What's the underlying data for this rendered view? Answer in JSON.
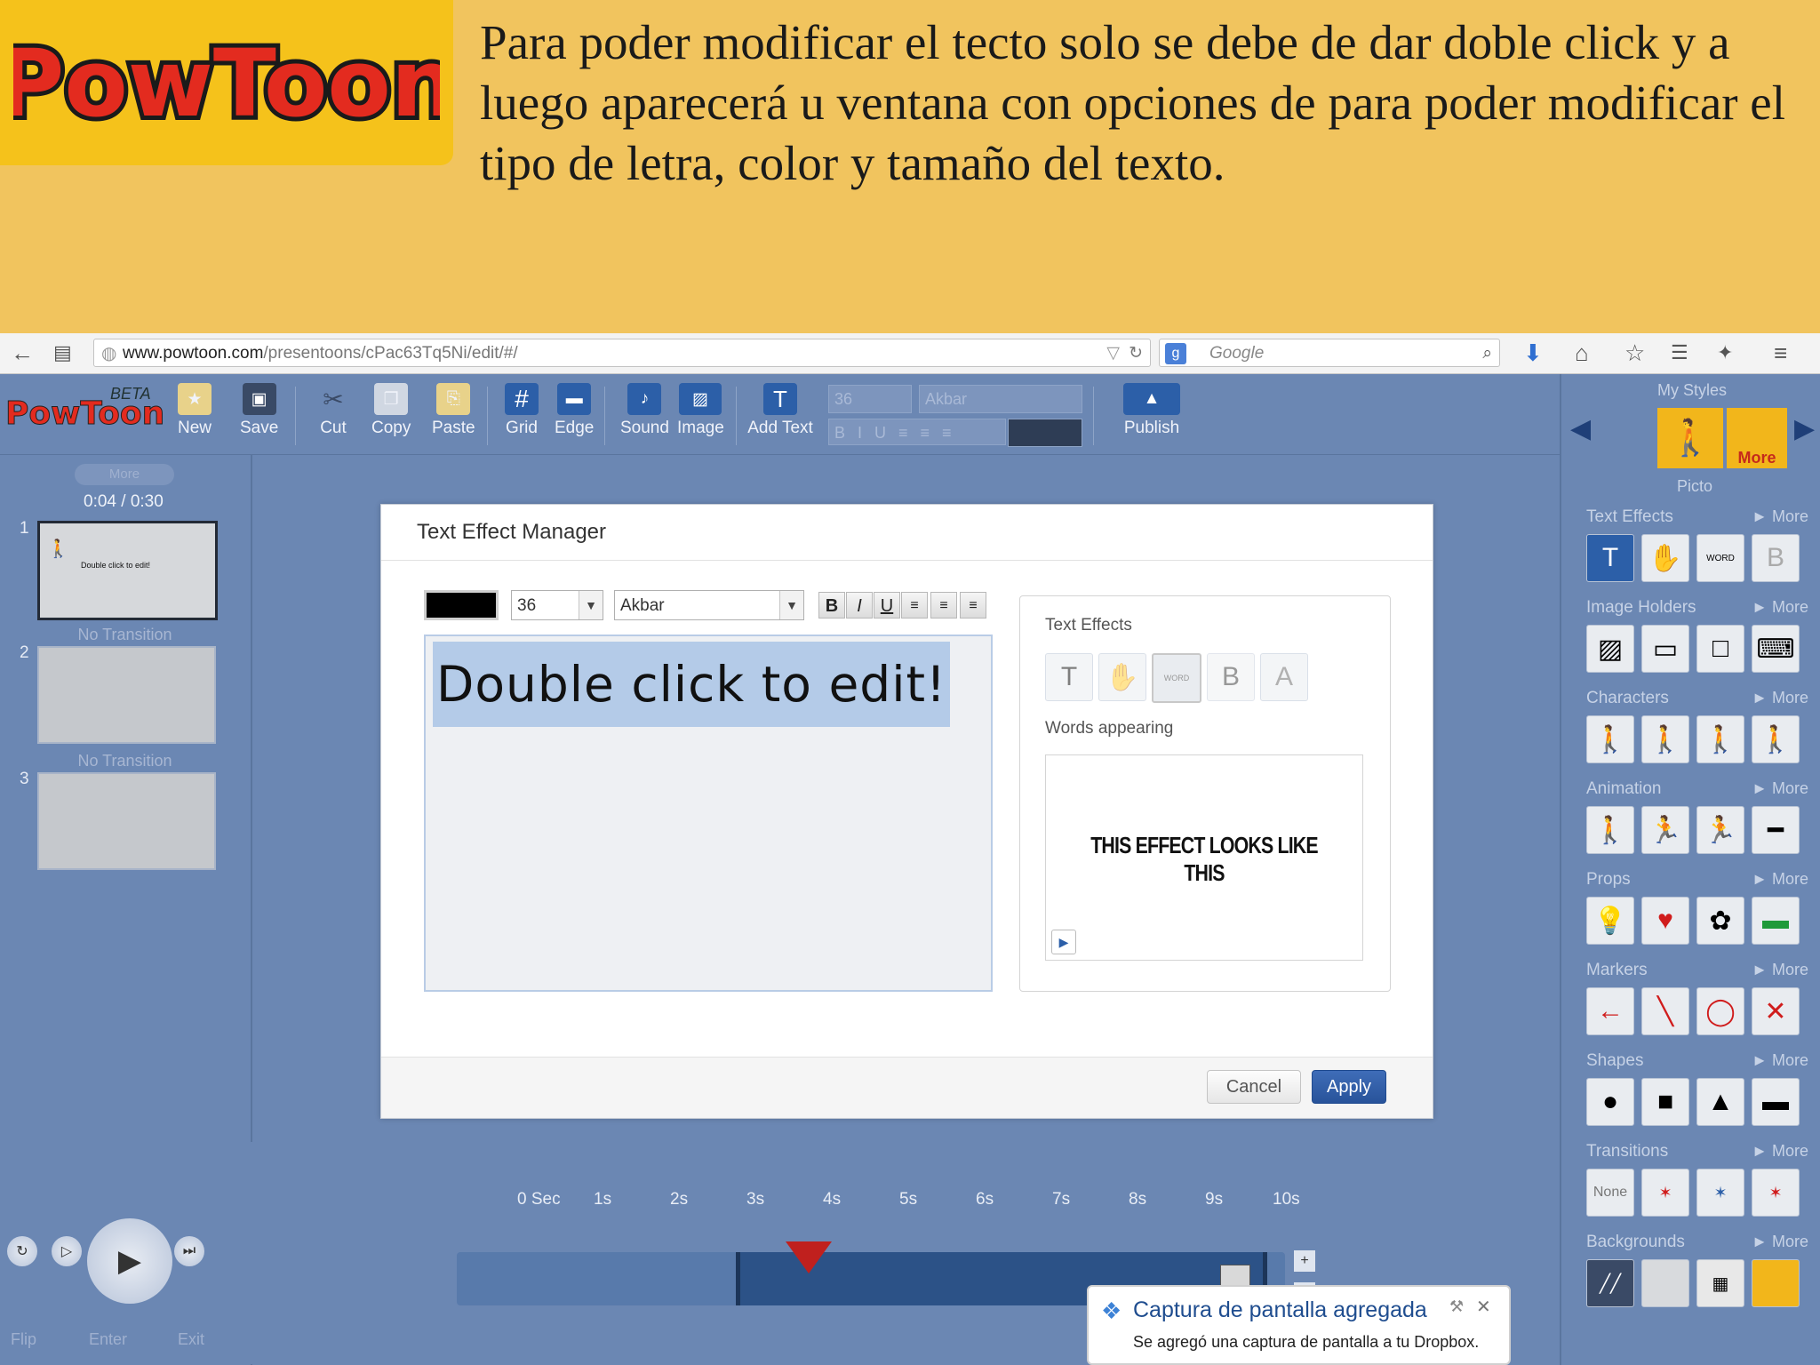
{
  "slide": {
    "caption": "Para poder modificar el tecto solo se debe de dar doble click y a luego aparecerá u ventana con opciones de  para poder modificar el  tipo de letra, color y  tamaño del texto.",
    "logo_text": "PowToon"
  },
  "browser": {
    "url_domain": "www.powtoon.com",
    "url_path": "/presentoons/cPac63Tq5Ni/edit/#/",
    "search_placeholder": "Google"
  },
  "app": {
    "logo": "PowToon",
    "beta": "BETA",
    "toolbar": [
      {
        "label": "New",
        "icon": "new-icon"
      },
      {
        "label": "Save",
        "icon": "save-icon"
      },
      {
        "label": "Cut",
        "icon": "cut-icon"
      },
      {
        "label": "Copy",
        "icon": "copy-icon"
      },
      {
        "label": "Paste",
        "icon": "paste-icon"
      },
      {
        "label": "Grid",
        "icon": "grid-icon"
      },
      {
        "label": "Edge",
        "icon": "edge-icon"
      },
      {
        "label": "Sound",
        "icon": "sound-icon"
      },
      {
        "label": "Image",
        "icon": "image-icon"
      },
      {
        "label": "Add Text",
        "icon": "text-icon"
      },
      {
        "label": "Publish",
        "icon": "publish-icon"
      }
    ],
    "font_size": "36",
    "font_name": "Akbar"
  },
  "left_panel": {
    "zoom_label": "More",
    "time": "0:04 / 0:30",
    "slides": [
      {
        "number": "1",
        "thumb_text": "Double click to edit!"
      },
      {
        "number": "2"
      },
      {
        "number": "3"
      }
    ],
    "transition_label": "No Transition"
  },
  "right_panel": {
    "my_styles": "My Styles",
    "style_name": "Picto",
    "more_label": "More",
    "sections": [
      {
        "title": "Text Effects"
      },
      {
        "title": "Image Holders"
      },
      {
        "title": "Characters"
      },
      {
        "title": "Animation"
      },
      {
        "title": "Props"
      },
      {
        "title": "Markers"
      },
      {
        "title": "Shapes"
      },
      {
        "title": "Transitions"
      },
      {
        "title": "Backgrounds"
      }
    ],
    "none_label": "None",
    "more_btn": "► More"
  },
  "modal": {
    "title": "Text Effect Manager",
    "font_size": "36",
    "font_name": "Akbar",
    "editor_text": "Double click to edit!",
    "effects_title": "Text Effects",
    "words_appearing": "Words appearing",
    "preview_text": "THIS EFFECT LOOKS LIKE THIS",
    "cancel": "Cancel",
    "apply": "Apply",
    "text_color": "#000000"
  },
  "timeline": {
    "ticks": [
      "0 Sec",
      "1s",
      "2s",
      "3s",
      "4s",
      "5s",
      "6s",
      "7s",
      "8s",
      "9s",
      "10s"
    ],
    "flip": "Flip",
    "enter": "Enter",
    "exit": "Exit"
  },
  "toast": {
    "title": "Captura de pantalla agregada",
    "body": "Se agregó una captura de pantalla a tu Dropbox."
  },
  "colors": {
    "app_bg": "#6b87b3",
    "slide_bg": "#f1c45e",
    "apply_btn": "#2d5aa3",
    "playhead": "#c0201e"
  }
}
